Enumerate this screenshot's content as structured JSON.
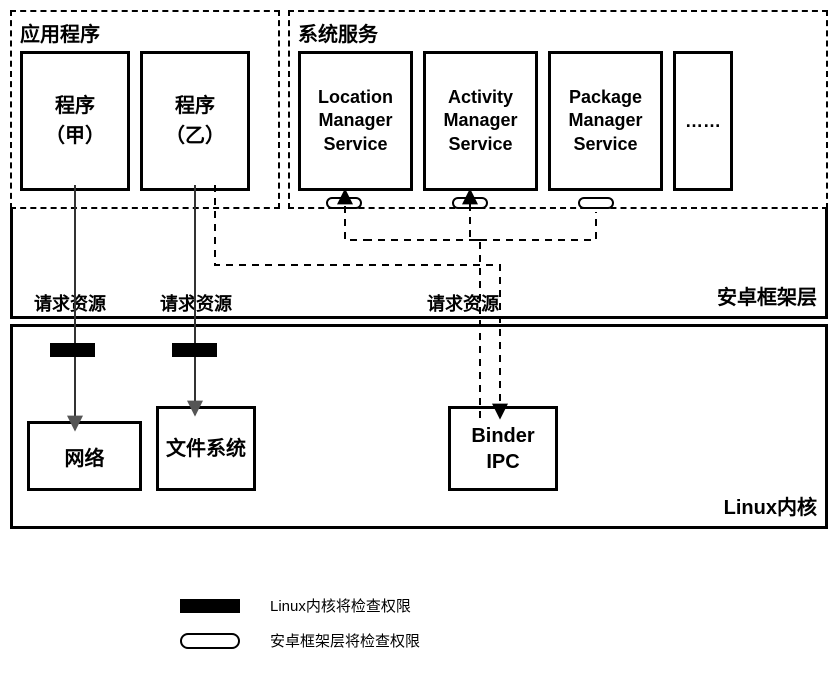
{
  "groups": {
    "apps_title": "应用程序",
    "services_title": "系统服务"
  },
  "apps": {
    "a_line1": "程序",
    "a_line2": "（甲）",
    "b_line1": "程序",
    "b_line2": "（乙）"
  },
  "services": {
    "loc1": "Location",
    "loc2": "Manager",
    "loc3": "Service",
    "act1": "Activity",
    "act2": "Manager",
    "act3": "Service",
    "pkg1": "Package",
    "pkg2": "Manager",
    "pkg3": "Service",
    "more": "……"
  },
  "layers": {
    "framework": "安卓框架层",
    "kernel": "Linux内核"
  },
  "kernel_boxes": {
    "net": "网络",
    "fs1": "文件",
    "fs2": "系统",
    "binder1": "Binder",
    "binder2": "IPC"
  },
  "labels": {
    "req1": "请求资源",
    "req2": "请求资源",
    "req3": "请求资源"
  },
  "legend": {
    "solid": "Linux内核将检查权限",
    "oval": "安卓框架层将检查权限"
  },
  "chart_data": {
    "type": "diagram",
    "title": "Android权限检查架构图",
    "layers": [
      {
        "name": "应用程序",
        "contains": [
          "程序（甲）",
          "程序（乙）"
        ]
      },
      {
        "name": "系统服务",
        "contains": [
          "Location Manager Service",
          "Activity Manager Service",
          "Package Manager Service",
          "……"
        ]
      },
      {
        "name": "安卓框架层"
      },
      {
        "name": "Linux内核",
        "contains": [
          "网络",
          "文件系统",
          "Binder IPC"
        ]
      }
    ],
    "edges": [
      {
        "from": "程序（甲）",
        "to": "网络",
        "label": "请求资源",
        "check": "Linux内核将检查权限",
        "style": "solid"
      },
      {
        "from": "程序（乙）",
        "to": "文件系统",
        "label": "请求资源",
        "check": "Linux内核将检查权限",
        "style": "solid"
      },
      {
        "from": "程序（乙）",
        "via": "安卓框架层",
        "to": "Binder IPC",
        "label": "请求资源",
        "style": "dashed"
      },
      {
        "from": "Binder IPC",
        "to": "Location Manager Service",
        "check": "安卓框架层将检查权限",
        "style": "dashed"
      },
      {
        "from": "Binder IPC",
        "to": "Activity Manager Service",
        "check": "安卓框架层将检查权限",
        "style": "dashed"
      },
      {
        "from": "Binder IPC",
        "to": "Package Manager Service",
        "check": "安卓框架层将检查权限",
        "style": "dashed"
      }
    ],
    "legend": [
      {
        "symbol": "solid-bar",
        "meaning": "Linux内核将检查权限"
      },
      {
        "symbol": "hollow-oval",
        "meaning": "安卓框架层将检查权限"
      }
    ]
  }
}
